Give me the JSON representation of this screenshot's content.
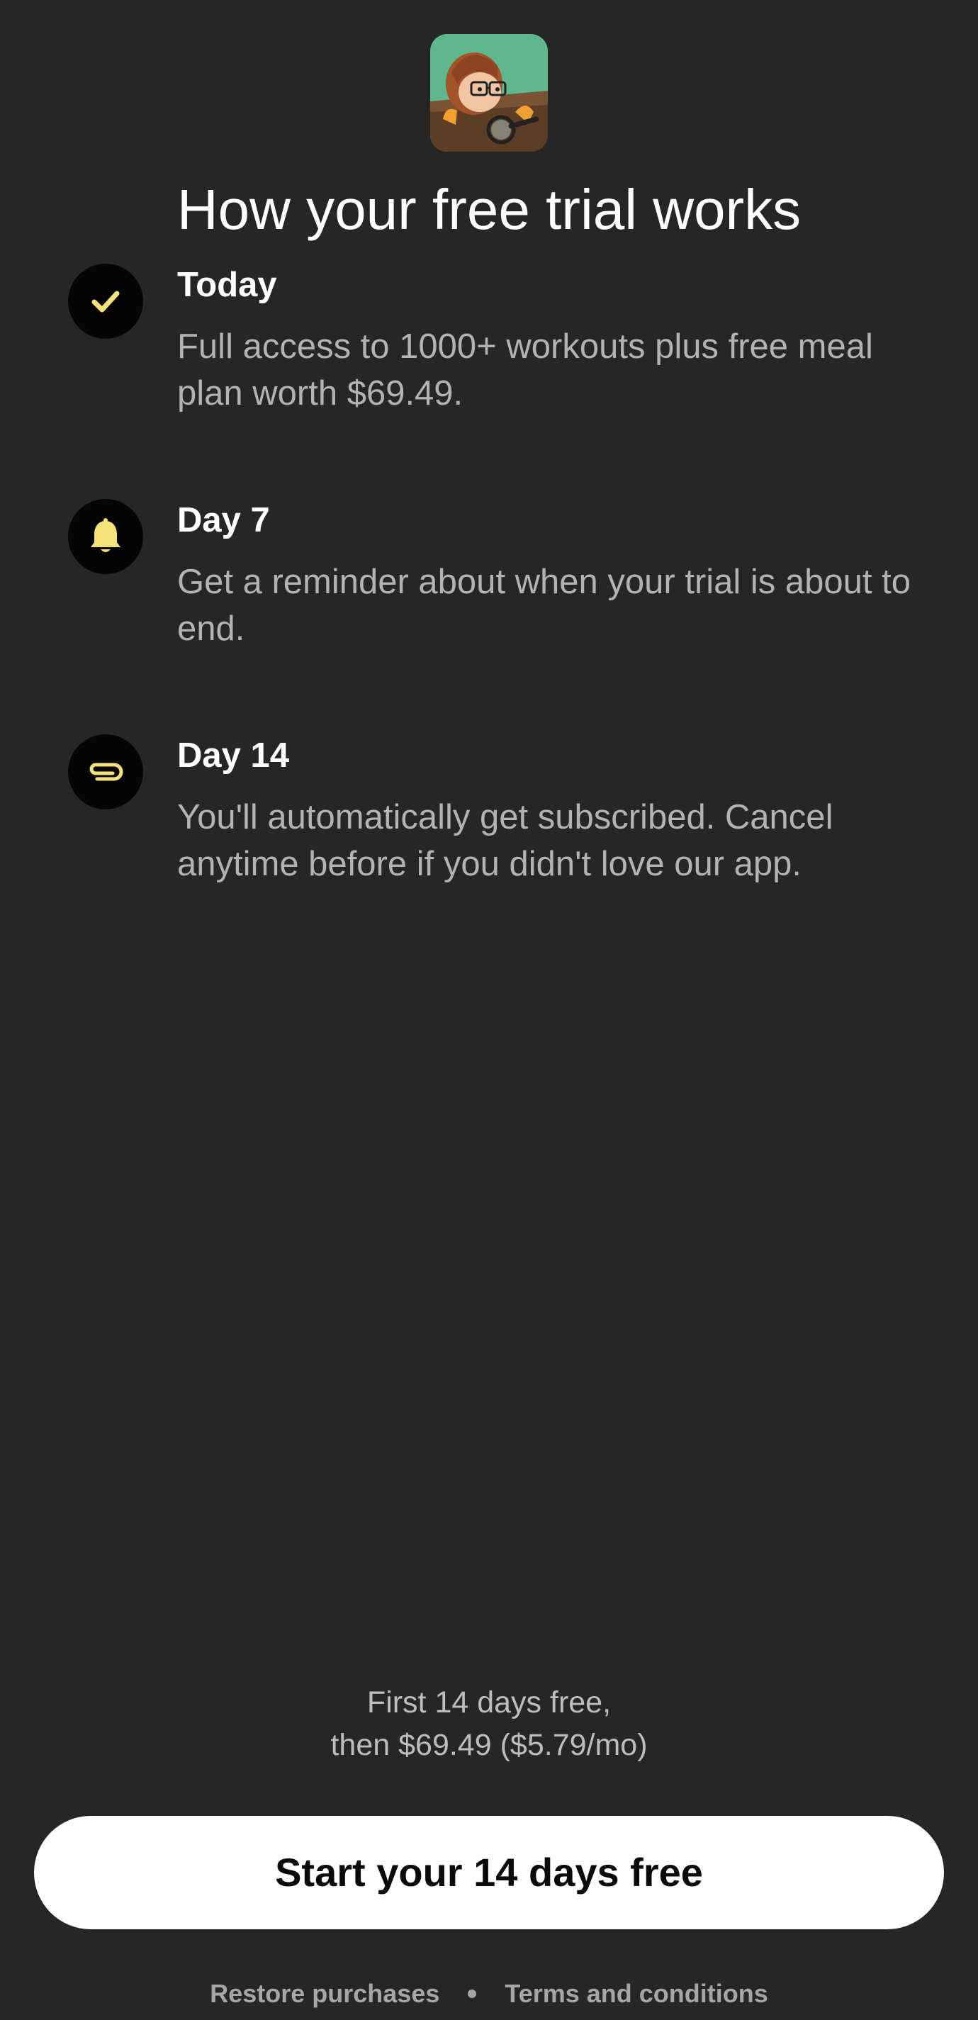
{
  "header": {
    "app_icon": "app-logo-illustration",
    "title": "How your free trial works"
  },
  "steps": [
    {
      "icon": "check-icon",
      "title": "Today",
      "description": "Full access to 1000+ workouts plus free meal plan worth $69.49."
    },
    {
      "icon": "bell-icon",
      "title": "Day 7",
      "description": "Get a reminder about when your trial is about to end."
    },
    {
      "icon": "subscription-icon",
      "title": "Day 14",
      "description": "You'll automatically get subscribed. Cancel anytime before if you didn't love our app."
    }
  ],
  "pricing": {
    "line1": "First 14 days free,",
    "line2": "then $69.49 ($5.79/mo)"
  },
  "cta": {
    "label": "Start your 14 days free"
  },
  "footer": {
    "restore_label": "Restore purchases",
    "terms_label": "Terms and conditions"
  },
  "colors": {
    "background": "#262626",
    "accent_yellow": "#f5e27a",
    "button_bg": "#ffffff",
    "muted_text": "#b3b3b3"
  }
}
